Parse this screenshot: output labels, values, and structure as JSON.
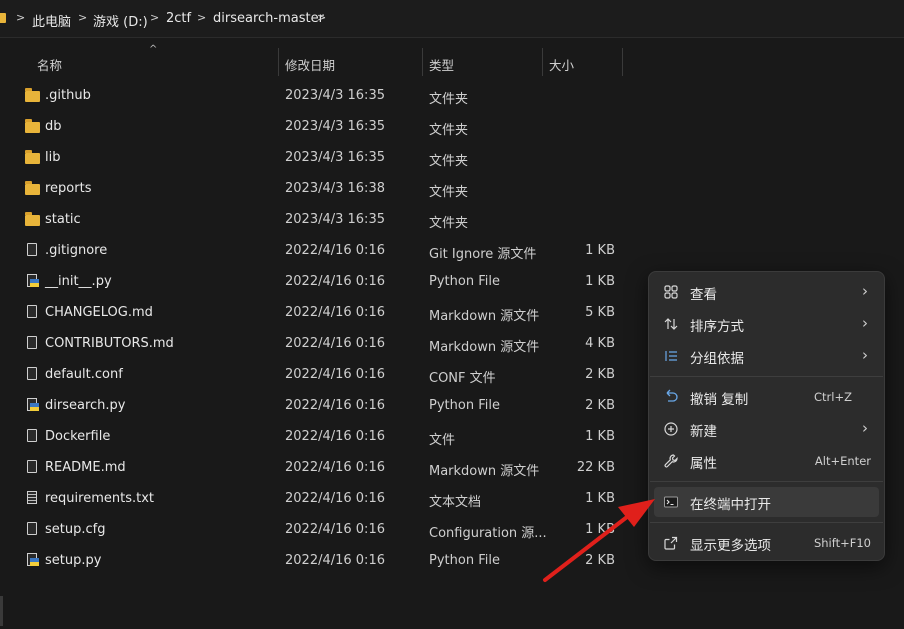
{
  "breadcrumb": {
    "items": [
      "此电脑",
      "游戏 (D:)",
      "2ctf",
      "dirsearch-master"
    ],
    "separator": ">"
  },
  "columns": {
    "name": "名称",
    "modified": "修改日期",
    "type": "类型",
    "size": "大小",
    "sort_indicator": "^"
  },
  "files": [
    {
      "name": ".github",
      "modified": "2023/4/3 16:35",
      "type": "文件夹",
      "size": "",
      "icon": "folder-icon"
    },
    {
      "name": "db",
      "modified": "2023/4/3 16:35",
      "type": "文件夹",
      "size": "",
      "icon": "folder-icon"
    },
    {
      "name": "lib",
      "modified": "2023/4/3 16:35",
      "type": "文件夹",
      "size": "",
      "icon": "folder-icon"
    },
    {
      "name": "reports",
      "modified": "2023/4/3 16:38",
      "type": "文件夹",
      "size": "",
      "icon": "folder-icon"
    },
    {
      "name": "static",
      "modified": "2023/4/3 16:35",
      "type": "文件夹",
      "size": "",
      "icon": "folder-icon"
    },
    {
      "name": ".gitignore",
      "modified": "2022/4/16 0:16",
      "type": "Git Ignore 源文件",
      "size": "1 KB",
      "icon": "file-icon"
    },
    {
      "name": "__init__.py",
      "modified": "2022/4/16 0:16",
      "type": "Python File",
      "size": "1 KB",
      "icon": "python-file-icon"
    },
    {
      "name": "CHANGELOG.md",
      "modified": "2022/4/16 0:16",
      "type": "Markdown 源文件",
      "size": "5 KB",
      "icon": "file-icon"
    },
    {
      "name": "CONTRIBUTORS.md",
      "modified": "2022/4/16 0:16",
      "type": "Markdown 源文件",
      "size": "4 KB",
      "icon": "file-icon"
    },
    {
      "name": "default.conf",
      "modified": "2022/4/16 0:16",
      "type": "CONF 文件",
      "size": "2 KB",
      "icon": "file-icon"
    },
    {
      "name": "dirsearch.py",
      "modified": "2022/4/16 0:16",
      "type": "Python File",
      "size": "2 KB",
      "icon": "python-file-icon"
    },
    {
      "name": "Dockerfile",
      "modified": "2022/4/16 0:16",
      "type": "文件",
      "size": "1 KB",
      "icon": "file-icon"
    },
    {
      "name": "README.md",
      "modified": "2022/4/16 0:16",
      "type": "Markdown 源文件",
      "size": "22 KB",
      "icon": "file-icon"
    },
    {
      "name": "requirements.txt",
      "modified": "2022/4/16 0:16",
      "type": "文本文档",
      "size": "1 KB",
      "icon": "text-file-icon"
    },
    {
      "name": "setup.cfg",
      "modified": "2022/4/16 0:16",
      "type": "Configuration 源...",
      "size": "1 KB",
      "icon": "file-icon"
    },
    {
      "name": "setup.py",
      "modified": "2022/4/16 0:16",
      "type": "Python File",
      "size": "2 KB",
      "icon": "python-file-icon"
    }
  ],
  "context_menu": {
    "view": {
      "label": "查看",
      "icon": "grid-icon"
    },
    "sort": {
      "label": "排序方式",
      "icon": "sort-icon"
    },
    "group": {
      "label": "分组依据",
      "icon": "group-icon"
    },
    "undo": {
      "label": "撤销 复制",
      "shortcut": "Ctrl+Z",
      "icon": "undo-icon"
    },
    "new": {
      "label": "新建",
      "icon": "plus-circle-icon"
    },
    "properties": {
      "label": "属性",
      "shortcut": "Alt+Enter",
      "icon": "wrench-icon"
    },
    "terminal": {
      "label": "在终端中打开",
      "icon": "terminal-icon"
    },
    "more": {
      "label": "显示更多选项",
      "shortcut": "Shift+F10",
      "icon": "share-icon"
    }
  },
  "colors": {
    "background": "#191919",
    "menu_background": "#2c2c2c",
    "folder": "#e8b43a",
    "arrow": "#e0201b"
  }
}
